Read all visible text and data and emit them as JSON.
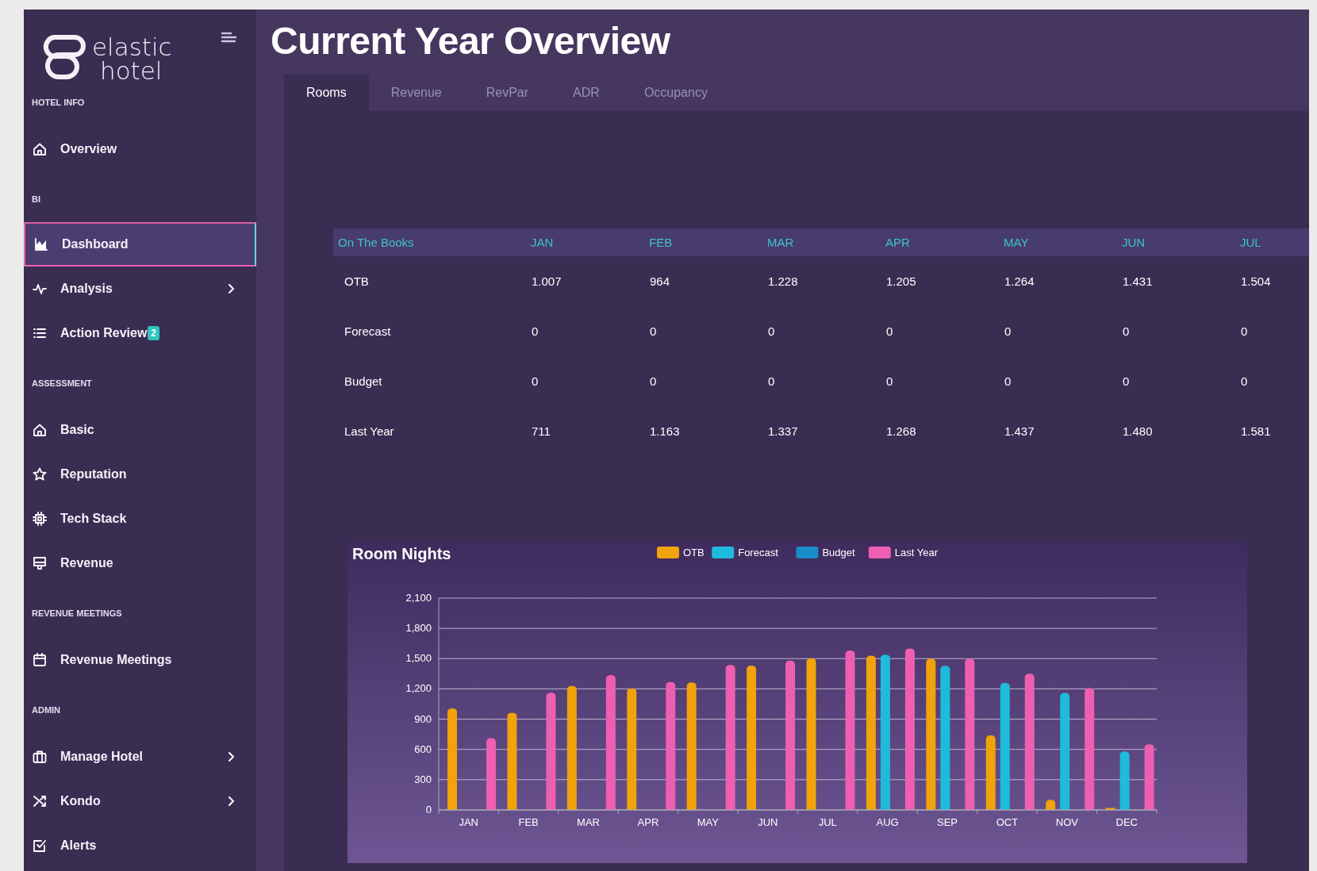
{
  "sidebar": {
    "logo": {
      "line_1": "elastic",
      "line_2": "hotel"
    },
    "sections": [
      {
        "title": "HOTEL INFO",
        "items": [
          {
            "label": "Overview",
            "selected": false,
            "expandable": false
          }
        ]
      },
      {
        "title": "BI",
        "items": [
          {
            "label": "Dashboard",
            "selected": true,
            "expandable": false
          },
          {
            "label": "Analysis",
            "selected": false,
            "expandable": true
          },
          {
            "label": "Action Review",
            "selected": false,
            "expandable": false,
            "badge": "2"
          }
        ]
      },
      {
        "title": "ASSESSMENT",
        "items": [
          {
            "label": "Basic",
            "selected": false,
            "expandable": false
          },
          {
            "label": "Reputation",
            "selected": false,
            "expandable": false
          },
          {
            "label": "Tech Stack",
            "selected": false,
            "expandable": false
          },
          {
            "label": "Revenue",
            "selected": false,
            "expandable": false
          }
        ]
      },
      {
        "title": "REVENUE MEETINGS",
        "items": [
          {
            "label": "Revenue Meetings",
            "selected": false,
            "expandable": false
          }
        ]
      },
      {
        "title": "ADMIN",
        "items": [
          {
            "label": "Manage Hotel",
            "selected": false,
            "expandable": true
          },
          {
            "label": "Kondo",
            "selected": false,
            "expandable": true
          },
          {
            "label": "Alerts",
            "selected": false,
            "expandable": false
          }
        ]
      }
    ]
  },
  "page": {
    "title": "Current Year Overview",
    "tabs": [
      {
        "label": "Rooms",
        "selected": true
      },
      {
        "label": "Revenue",
        "selected": false
      },
      {
        "label": "RevPar",
        "selected": false
      },
      {
        "label": "ADR",
        "selected": false
      },
      {
        "label": "Occupancy",
        "selected": false
      }
    ],
    "table": {
      "columns": [
        "On The Books",
        "JAN",
        "FEB",
        "MAR",
        "APR",
        "MAY",
        "JUN",
        "JUL"
      ],
      "rows": [
        [
          "OTB",
          "1.007",
          "964",
          "1.228",
          "1.205",
          "1.264",
          "1.431",
          "1.504"
        ],
        [
          "Forecast",
          "0",
          "0",
          "0",
          "0",
          "0",
          "0",
          "0"
        ],
        [
          "Budget",
          "0",
          "0",
          "0",
          "0",
          "0",
          "0",
          "0"
        ],
        [
          "Last Year",
          "711",
          "1.163",
          "1.337",
          "1.268",
          "1.437",
          "1.480",
          "1.581"
        ]
      ]
    },
    "chart": {
      "chart_data": {
        "type": "bar",
        "title": "Room Nights",
        "categories": [
          "JAN",
          "FEB",
          "MAR",
          "APR",
          "MAY",
          "JUN",
          "JUL",
          "AUG",
          "SEP",
          "OCT",
          "NOV",
          "DEC"
        ],
        "series": [
          {
            "name": "OTB",
            "color": "#f0a30a",
            "values": [
              1007,
              964,
              1228,
              1205,
              1264,
              1431,
              1504,
              1530,
              1500,
              740,
              100,
              20
            ]
          },
          {
            "name": "Forecast",
            "color": "#1ebbdc",
            "values": [
              0,
              0,
              0,
              0,
              0,
              0,
              0,
              1540,
              1430,
              1260,
              1160,
              580
            ]
          },
          {
            "name": "Budget",
            "color": "#1a8cc8",
            "values": [
              0,
              0,
              0,
              0,
              0,
              0,
              0,
              0,
              0,
              0,
              0,
              0
            ]
          },
          {
            "name": "Last Year",
            "color": "#ee5fb2",
            "values": [
              711,
              1163,
              1337,
              1268,
              1437,
              1480,
              1581,
              1600,
              1500,
              1350,
              1210,
              650
            ]
          }
        ],
        "ylim": [
          0,
          2100
        ],
        "grid": true,
        "legend": "top",
        "yticks": [
          0,
          300,
          600,
          900,
          {
            "value": 1200,
            "label": "1,200"
          },
          {
            "value": 1500,
            "label": "1,500"
          },
          {
            "value": 1800,
            "label": "1,800"
          },
          {
            "value": 2100,
            "label": "2,100"
          }
        ]
      }
    }
  }
}
